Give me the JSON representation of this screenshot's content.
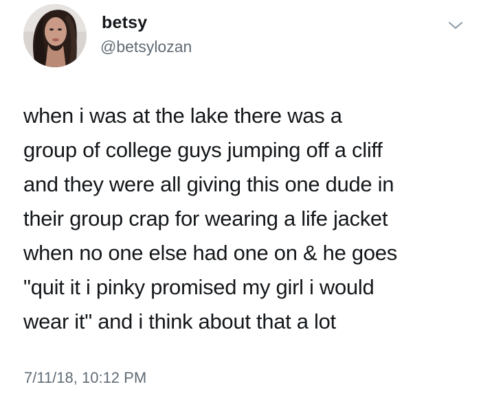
{
  "author": {
    "display_name": "betsy",
    "handle": "@betsylozan",
    "avatar_icon": "profile-photo"
  },
  "menu_icon": "chevron-down-icon",
  "tweet": {
    "lines": [
      "when i was at the lake there was a",
      "group of college guys jumping off a cliff",
      "and they were all giving this one dude in",
      "their group crap for wearing a life jacket",
      "when no one else had one on & he goes",
      "\"quit it i pinky promised my girl i would",
      "wear it\" and i think about that a lot"
    ],
    "timestamp": "7/11/18, 10:12 PM"
  },
  "colors": {
    "text": "#14171a",
    "secondary_text": "#606b75",
    "chevron": "#8899a6",
    "background": "#ffffff"
  }
}
